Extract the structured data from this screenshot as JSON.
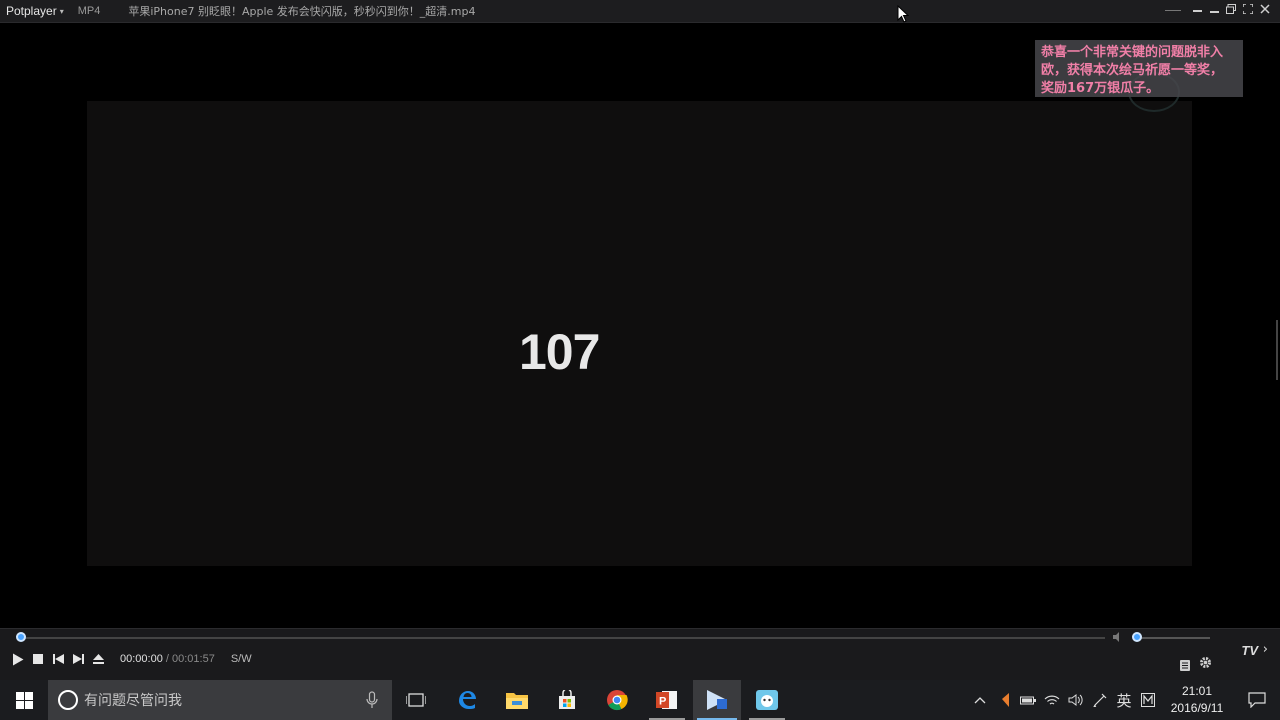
{
  "titlebar": {
    "brand": "Potplayer",
    "format": "MP4",
    "filename": "苹果iPhone7 别眨眼！Apple 发布会快闪版，秒秒闪到你！_超清.mp4"
  },
  "video": {
    "displayed_number": "107"
  },
  "overlay": {
    "lines": [
      "恭喜一个非常关键的问题脱非入",
      "欧，获得本次绘马祈愿一等奖，",
      "奖励167万银瓜子。"
    ]
  },
  "controls": {
    "current_time": "00:00:00",
    "total_time": " / 00:01:57",
    "sw_label": "S/W",
    "tv_label": "TV",
    "seek_position": 0.0,
    "volume_level": 0.0
  },
  "taskbar": {
    "search_placeholder": "有问题尽管问我",
    "ime_label": "英",
    "time": "21:01",
    "date": "2016/9/11"
  },
  "colors": {
    "accent": "#4aa3ff",
    "overlay_text": "#f07fa7",
    "taskbar_active": "#76b9ed"
  }
}
